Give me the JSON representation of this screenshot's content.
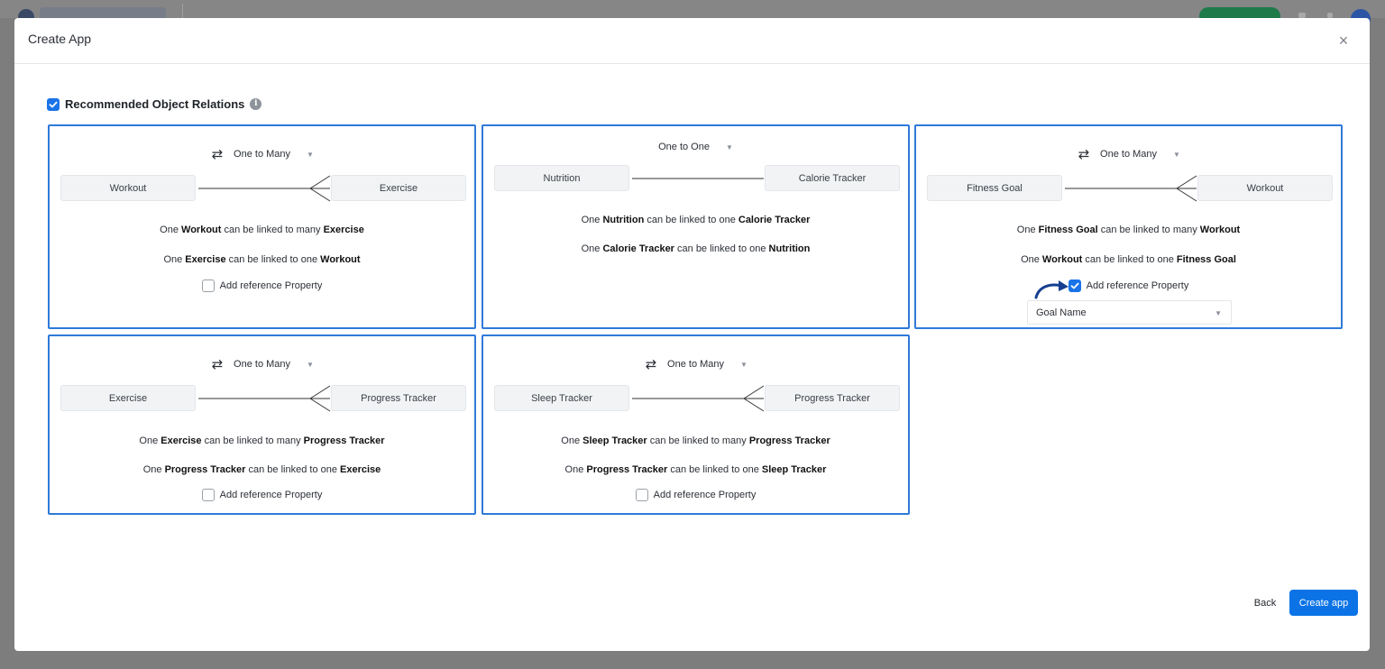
{
  "dialog": {
    "title": "Create App",
    "close_glyph": "×"
  },
  "section": {
    "title": "Recommended Object Relations",
    "checked": true,
    "info_glyph": "i"
  },
  "relations": [
    {
      "type_label": "One to Many",
      "show_swap": true,
      "left": "Workout",
      "right": "Exercise",
      "line1": {
        "a": "One ",
        "b": "Workout",
        "c": " can be linked to many ",
        "d": "Exercise"
      },
      "line2": {
        "a": "One ",
        "b": "Exercise",
        "c": " can be linked to one ",
        "d": "Workout"
      },
      "ref_label": "Add reference Property",
      "ref_checked": false
    },
    {
      "type_label": "One to One",
      "show_swap": false,
      "left": "Nutrition",
      "right": "Calorie Tracker",
      "line1": {
        "a": "One ",
        "b": "Nutrition",
        "c": " can be linked to one ",
        "d": "Calorie Tracker"
      },
      "line2": {
        "a": "One ",
        "b": "Calorie Tracker",
        "c": " can be linked to one ",
        "d": "Nutrition"
      }
    },
    {
      "type_label": "One to Many",
      "show_swap": true,
      "left": "Fitness Goal",
      "right": "Workout",
      "line1": {
        "a": "One ",
        "b": "Fitness Goal",
        "c": " can be linked to many ",
        "d": "Workout"
      },
      "line2": {
        "a": "One ",
        "b": "Workout",
        "c": " can be linked to one ",
        "d": "Fitness Goal"
      },
      "ref_label": "Add reference Property",
      "ref_checked": true,
      "ref_property": "Goal Name"
    },
    {
      "type_label": "One to Many",
      "show_swap": true,
      "left": "Exercise",
      "right": "Progress Tracker",
      "line1": {
        "a": "One ",
        "b": "Exercise",
        "c": " can be linked to many ",
        "d": "Progress Tracker"
      },
      "line2": {
        "a": "One ",
        "b": "Progress Tracker",
        "c": " can be linked to one ",
        "d": "Exercise"
      },
      "ref_label": "Add reference Property",
      "ref_checked": false
    },
    {
      "type_label": "One to Many",
      "show_swap": true,
      "left": "Sleep Tracker",
      "right": "Progress Tracker",
      "line1": {
        "a": "One ",
        "b": "Sleep Tracker",
        "c": " can be linked to many ",
        "d": "Progress Tracker"
      },
      "line2": {
        "a": "One ",
        "b": "Progress Tracker",
        "c": " can be linked to one ",
        "d": "Sleep Tracker"
      },
      "ref_label": "Add reference Property",
      "ref_checked": false
    }
  ],
  "footer": {
    "back_label": "Back",
    "create_label": "Create app"
  },
  "colors": {
    "accent": "#1a73e8",
    "card_border": "#2f7ad9",
    "primary_button": "#0b73e6"
  },
  "icons": {
    "swap": "⇄",
    "caret": "▼"
  }
}
